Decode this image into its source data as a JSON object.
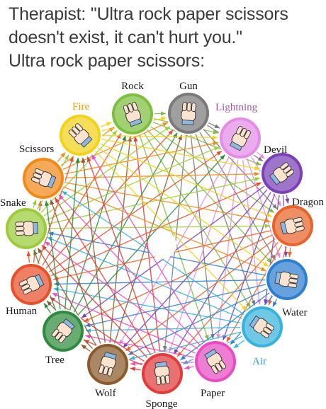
{
  "caption": {
    "line1": "Therapist: \"Ultra rock paper scissors",
    "line2": "doesn't exist, it can't hurt you.\"",
    "line3": "Ultra rock paper scissors:"
  },
  "diagram": {
    "nodes": [
      {
        "id": "rock",
        "label": "Rock",
        "color": "#7fbf3f",
        "label_color": "#1a1a1a",
        "icon": "fist-hand-icon"
      },
      {
        "id": "gun",
        "label": "Gun",
        "color": "#7a7a7a",
        "label_color": "#1a1a1a",
        "icon": "finger-gun-hand-icon"
      },
      {
        "id": "lightning",
        "label": "Lightning",
        "color": "#e48de6",
        "label_color": "#a05aa8",
        "icon": "lightning-hand-icon"
      },
      {
        "id": "devil",
        "label": "Devil",
        "color": "#7b3fb8",
        "label_color": "#1a1a1a",
        "icon": "horns-hand-icon"
      },
      {
        "id": "dragon",
        "label": "Dragon",
        "color": "#e8632a",
        "label_color": "#1a1a1a",
        "icon": "dragon-hand-icon"
      },
      {
        "id": "water",
        "label": "Water",
        "color": "#2f7fd1",
        "label_color": "#1a1a1a",
        "icon": "water-hand-icon"
      },
      {
        "id": "air",
        "label": "Air",
        "color": "#36b3dd",
        "label_color": "#3a9fc4",
        "icon": "air-hand-icon"
      },
      {
        "id": "paper",
        "label": "Paper",
        "color": "#e84dc2",
        "label_color": "#1a1a1a",
        "icon": "flat-hand-icon"
      },
      {
        "id": "sponge",
        "label": "Sponge",
        "color": "#e23b3b",
        "label_color": "#1a1a1a",
        "icon": "sponge-hand-icon"
      },
      {
        "id": "wolf",
        "label": "Wolf",
        "color": "#8a5a2b",
        "label_color": "#1a1a1a",
        "icon": "wolf-hand-icon"
      },
      {
        "id": "tree",
        "label": "Tree",
        "color": "#2e8b3e",
        "label_color": "#1a1a1a",
        "icon": "tree-hand-icon"
      },
      {
        "id": "human",
        "label": "Human",
        "color": "#e8502a",
        "label_color": "#1a1a1a",
        "icon": "human-hand-icon"
      },
      {
        "id": "snake",
        "label": "Snake",
        "color": "#9ccc3a",
        "label_color": "#1a1a1a",
        "icon": "snake-hand-icon"
      },
      {
        "id": "scissors",
        "label": "Scissors",
        "color": "#f28a1a",
        "label_color": "#1a1a1a",
        "icon": "scissors-hand-icon"
      },
      {
        "id": "fire",
        "label": "Fire",
        "color": "#f2d21a",
        "label_color": "#d9a21a",
        "icon": "fire-hand-icon"
      }
    ]
  }
}
